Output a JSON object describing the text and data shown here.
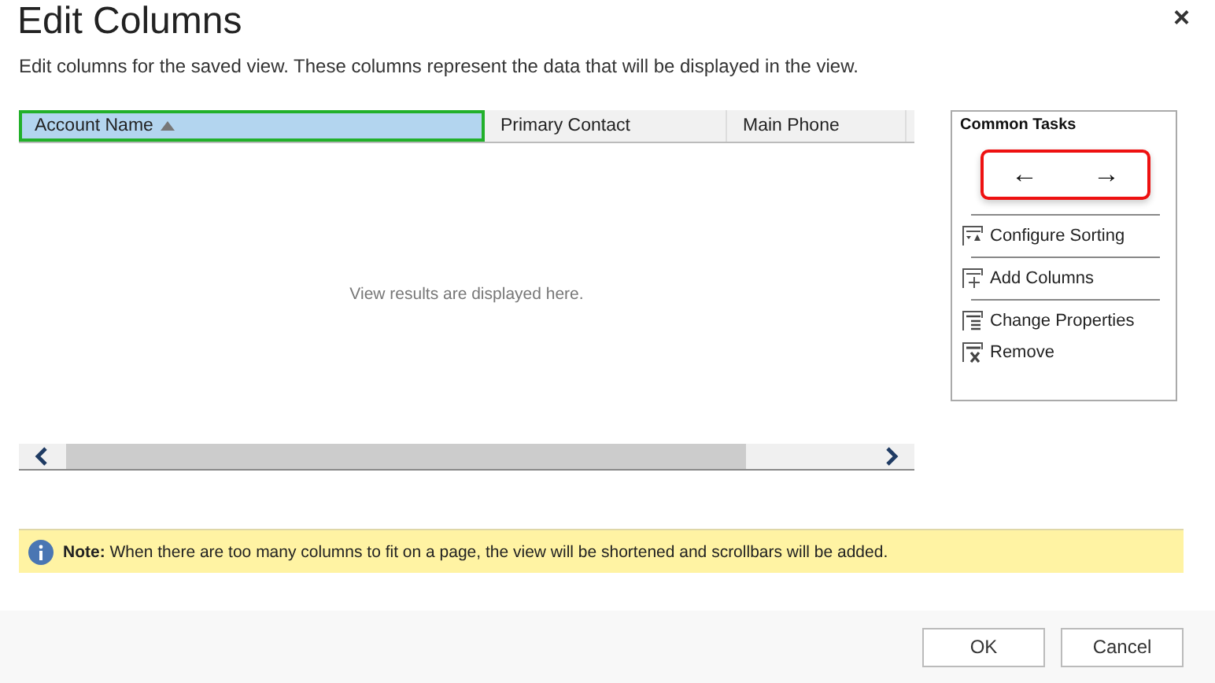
{
  "dialog": {
    "title": "Edit Columns",
    "close": "×",
    "description": "Edit columns for the saved view. These columns represent the data that will be displayed in the view."
  },
  "grid": {
    "columns": [
      {
        "label": "Account Name",
        "selected": true,
        "sorted_ascending": true
      },
      {
        "label": "Primary Contact",
        "selected": false,
        "sorted_ascending": false
      },
      {
        "label": "Main Phone",
        "selected": false,
        "sorted_ascending": false
      }
    ],
    "empty_message": "View results are displayed here."
  },
  "common_tasks": {
    "title": "Common Tasks",
    "move_left": "←",
    "move_right": "→",
    "items": [
      {
        "kind": "sort",
        "label": "Configure Sorting"
      },
      {
        "kind": "add",
        "label": "Add Columns"
      },
      {
        "kind": "properties",
        "label": "Change Properties"
      },
      {
        "kind": "remove",
        "label": "Remove"
      }
    ]
  },
  "note": {
    "text": "**Note:** When there are too many columns to fit on a page, the view will be shortened and scrollbars will be added."
  },
  "buttons": [
    "OK",
    "Cancel"
  ]
}
